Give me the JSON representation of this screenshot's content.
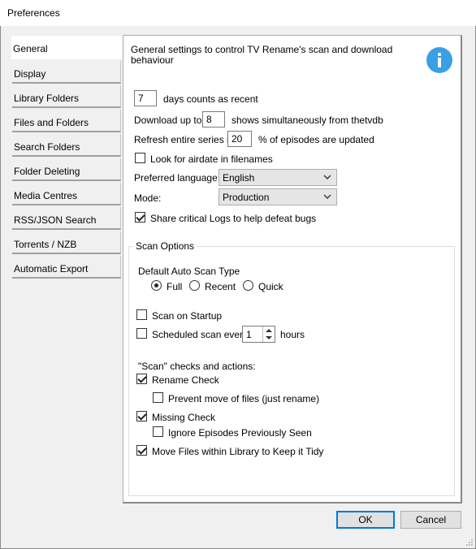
{
  "window": {
    "title": "Preferences"
  },
  "tabs": [
    "General",
    "Display",
    "Library Folders",
    "Files and Folders",
    "Search Folders",
    "Folder Deleting",
    "Media Centres",
    "RSS/JSON Search",
    "Torrents / NZB",
    "Automatic Export"
  ],
  "active_tab": "General",
  "general": {
    "description": "General settings to control TV Rename's scan and download",
    "description2": "behaviour",
    "recent_days_value": "7",
    "recent_days_label": "days counts as recent",
    "download_label": "Download up to",
    "download_value": "8",
    "download_suffix": "shows simultaneously from thetvdb",
    "refresh_label": "Refresh entire series  if",
    "refresh_value": "20",
    "refresh_suffix": "% of episodes are updated",
    "airdate_label": "Look for airdate in filenames",
    "airdate_checked": false,
    "language_label": "Preferred language:",
    "language_value": "English",
    "mode_label": "Mode:",
    "mode_value": "Production",
    "share_logs_label": "Share critical Logs to help defeat bugs",
    "share_logs_checked": true
  },
  "scan_options": {
    "group_title": "Scan Options",
    "auto_scan_label": "Default Auto Scan Type",
    "radio_full": "Full",
    "radio_recent": "Recent",
    "radio_quick": "Quick",
    "selected": "Full",
    "scan_on_startup_label": "Scan on Startup",
    "scan_on_startup_checked": false,
    "scheduled_label": "Scheduled scan every",
    "scheduled_value": "1",
    "scheduled_unit": "hours",
    "scheduled_checked": false,
    "checks_heading": "\"Scan\" checks and actions:",
    "rename_check": "Rename Check",
    "rename_checked": true,
    "prevent_move": "Prevent move of files (just rename)",
    "prevent_move_checked": false,
    "missing_check": "Missing Check",
    "missing_checked": true,
    "ignore_previously_seen": "Ignore Episodes Previously Seen",
    "ignore_checked": false,
    "move_files": "Move Files within Library to Keep it Tidy",
    "move_files_checked": true
  },
  "buttons": {
    "ok": "OK",
    "cancel": "Cancel"
  },
  "colors": {
    "accent": "#0078d7",
    "info_icon": "#3aa0e6"
  },
  "icons": {
    "info": "info-icon",
    "chevron": "chevron-down-icon",
    "grip": "resize-grip-icon"
  }
}
